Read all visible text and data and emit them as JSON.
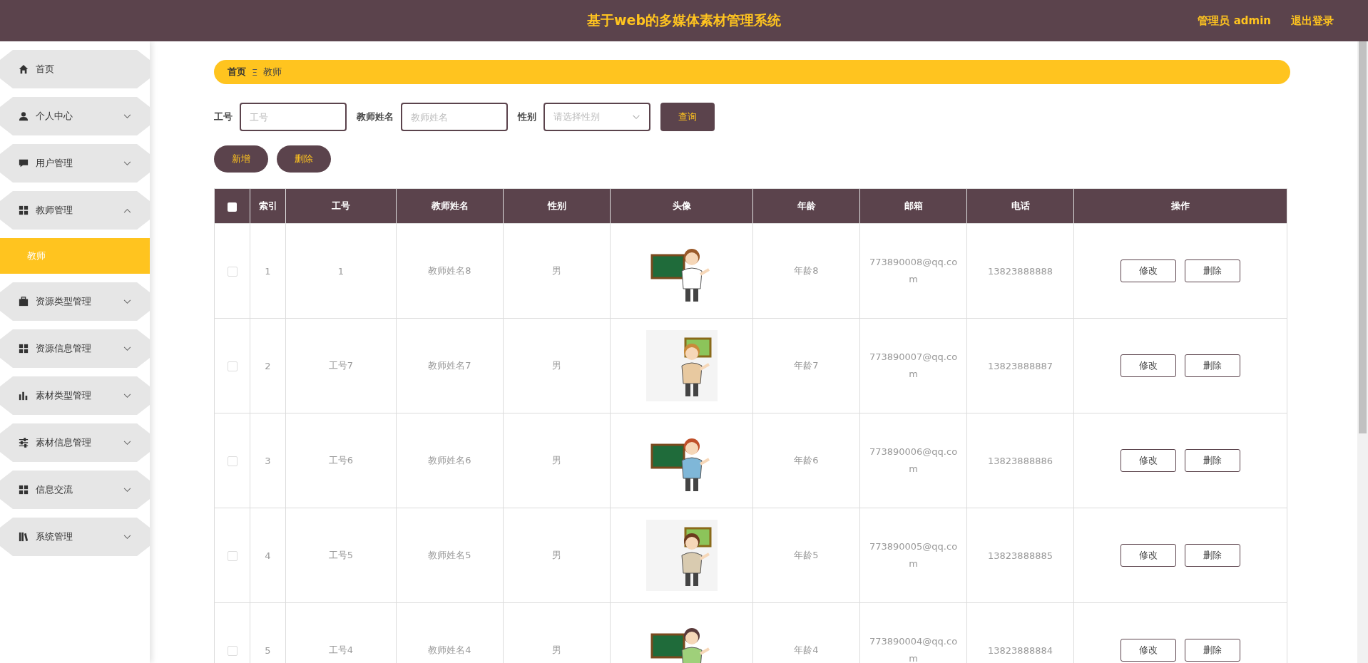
{
  "header": {
    "title": "基于web的多媒体素材管理系统",
    "user": "管理员 admin",
    "logout": "退出登录"
  },
  "sidebar": {
    "items": [
      {
        "label": "首页",
        "kind": "link"
      },
      {
        "label": "个人中心",
        "kind": "menu",
        "expanded": false
      },
      {
        "label": "用户管理",
        "kind": "menu",
        "expanded": false
      },
      {
        "label": "教师管理",
        "kind": "menu",
        "expanded": true,
        "children": [
          {
            "label": "教师",
            "selected": true
          }
        ]
      },
      {
        "label": "资源类型管理",
        "kind": "menu",
        "expanded": false
      },
      {
        "label": "资源信息管理",
        "kind": "menu",
        "expanded": false
      },
      {
        "label": "素材类型管理",
        "kind": "menu",
        "expanded": false
      },
      {
        "label": "素材信息管理",
        "kind": "menu",
        "expanded": false
      },
      {
        "label": "信息交流",
        "kind": "menu",
        "expanded": false
      },
      {
        "label": "系统管理",
        "kind": "menu",
        "expanded": false
      }
    ]
  },
  "breadcrumb": {
    "items": [
      "首页",
      "教师"
    ],
    "separator": "Ξ"
  },
  "search": {
    "fields": [
      {
        "label": "工号",
        "placeholder": "工号",
        "kind": "input"
      },
      {
        "label": "教师姓名",
        "placeholder": "教师姓名",
        "kind": "input"
      },
      {
        "label": "性别",
        "placeholder": "请选择性别",
        "kind": "select"
      }
    ],
    "button": "查询"
  },
  "actions": [
    "新增",
    "删除"
  ],
  "table": {
    "select_all": {
      "checked": false
    },
    "columns": [
      "索引",
      "工号",
      "教师姓名",
      "性别",
      "头像",
      "年龄",
      "邮箱",
      "电话",
      "操作"
    ],
    "rows": [
      {
        "checked": false,
        "index": "1",
        "id": "1",
        "name": "教师姓名8",
        "gender": "男",
        "age": "年龄8",
        "email": "773890008@qq.com",
        "phone": "13823888888",
        "actions": [
          "修改",
          "删除"
        ]
      },
      {
        "checked": false,
        "index": "2",
        "id": "工号7",
        "name": "教师姓名7",
        "gender": "男",
        "age": "年龄7",
        "email": "773890007@qq.com",
        "phone": "13823888887",
        "actions": [
          "修改",
          "删除"
        ]
      },
      {
        "checked": false,
        "index": "3",
        "id": "工号6",
        "name": "教师姓名6",
        "gender": "男",
        "age": "年龄6",
        "email": "773890006@qq.com",
        "phone": "13823888886",
        "actions": [
          "修改",
          "删除"
        ]
      },
      {
        "checked": false,
        "index": "4",
        "id": "工号5",
        "name": "教师姓名5",
        "gender": "男",
        "age": "年龄5",
        "email": "773890005@qq.com",
        "phone": "13823888885",
        "actions": [
          "修改",
          "删除"
        ]
      },
      {
        "checked": false,
        "index": "5",
        "id": "工号4",
        "name": "教师姓名4",
        "gender": "男",
        "age": "年龄4",
        "email": "773890004@qq.com",
        "phone": "13823888884",
        "actions": [
          "修改",
          "删除"
        ]
      }
    ]
  }
}
